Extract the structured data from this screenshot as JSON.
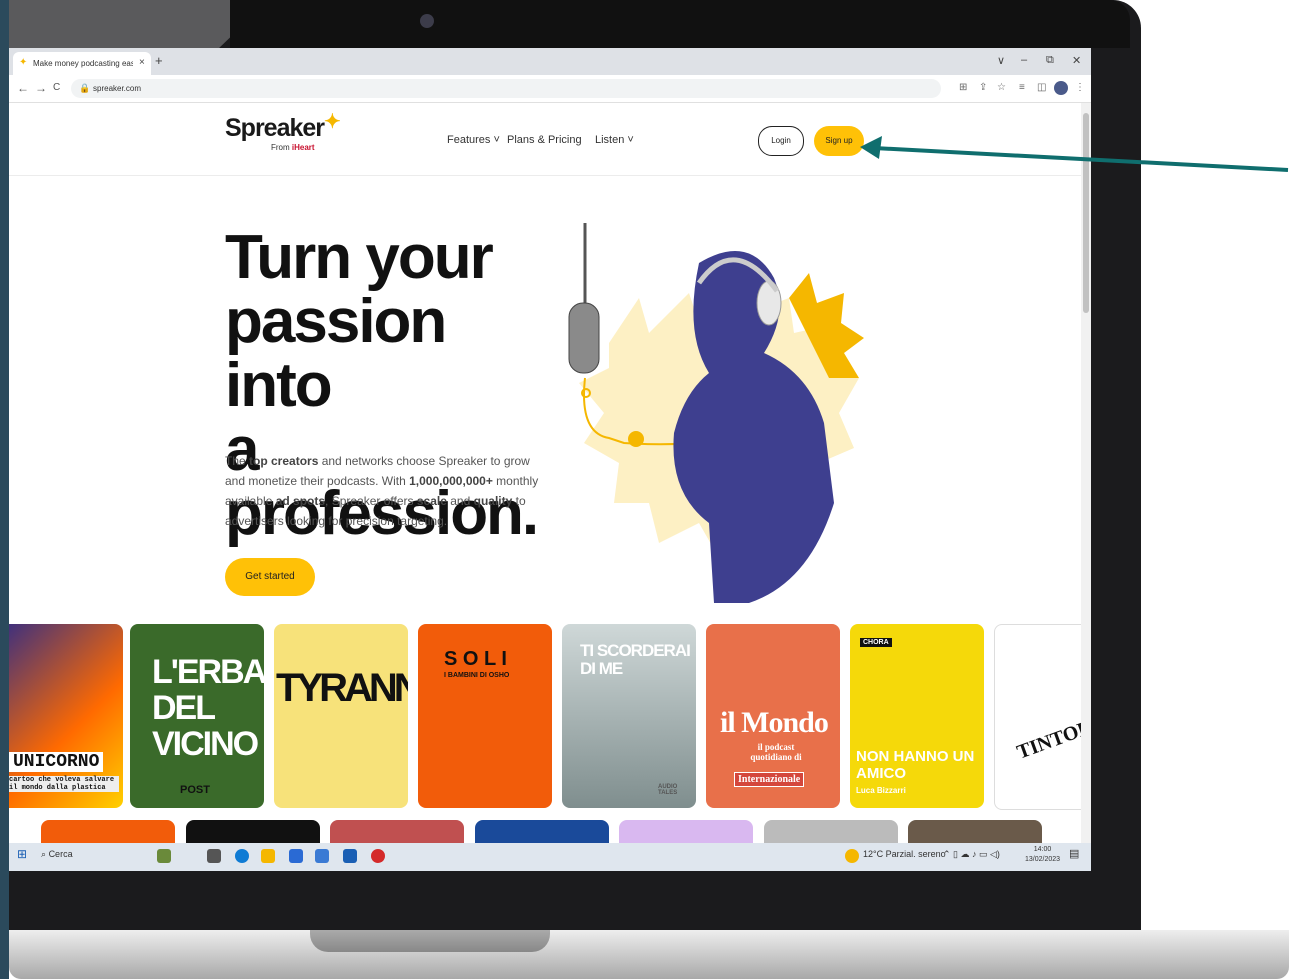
{
  "browser": {
    "tab_title": "Make money podcasting easily •",
    "tab_favicon": "star-favicon",
    "new_tab": "+",
    "tab_close": "×",
    "window_controls": [
      "∨",
      "–",
      "⧉",
      "✕"
    ],
    "nav": {
      "back": "←",
      "forward": "→",
      "reload": "C"
    },
    "url": "spreaker.com",
    "extension_icons": [
      "translate-icon",
      "share-icon",
      "star-icon",
      "reading-list-icon",
      "sidebar-icon"
    ],
    "menu_icon": "⋮"
  },
  "site": {
    "logo": "Spreaker",
    "logo_sub_prefix": "From",
    "logo_sub_brand": "iHeart",
    "menu": [
      {
        "label": "Features ˅"
      },
      {
        "label": "Plans & Pricing"
      },
      {
        "label": "Listen ˅"
      }
    ],
    "login_label": "Login",
    "signup_label": "Sign up"
  },
  "hero": {
    "title_line1": "Turn your",
    "title_line2": "passion into",
    "title_line3": "a profession.",
    "body_1": "The ",
    "body_2": "top creators",
    "body_3": " and networks choose Spreaker to grow and monetize their podcasts. With ",
    "body_4": "1,000,000,000+",
    "body_5": " monthly available ",
    "body_6": "ad spots",
    "body_7": ", Spreaker offers ",
    "body_8": "scale",
    "body_9": " and ",
    "body_10": "quality",
    "body_11": " to advertisers looking for precision targeting.",
    "cta_label": "Get started"
  },
  "podcasts": [
    {
      "title": "UNICORNO",
      "sub": "cartoo che voleva salvare il mondo dalla plastica"
    },
    {
      "title": "L'ERBA DEL VICINO",
      "sub": "POST"
    },
    {
      "title": "TYRANNY",
      "sub": ""
    },
    {
      "title": "S O L I",
      "sub": "I BAMBINI DI OSHO"
    },
    {
      "title": "TI SCORDERAI DI ME",
      "sub": "AUDIO TALES"
    },
    {
      "title": "il Mondo",
      "sub": "il podcast quotidiano di",
      "brand": "Internazionale"
    },
    {
      "title": "NON HANNO UN AMICO",
      "sub": "Luca Bizzarri",
      "tag": "CHORA"
    },
    {
      "title": "TINTORIA",
      "sub": ""
    }
  ],
  "taskbar": {
    "search": "Cerca",
    "weather": "12°C Parzial. sereno",
    "time": "14:00",
    "date": "13/02/2023"
  },
  "colors": {
    "brand_yellow": "#ffc107",
    "annotation_arrow": "#0f6e6e",
    "portrait_blue": "#3e3f8f"
  }
}
